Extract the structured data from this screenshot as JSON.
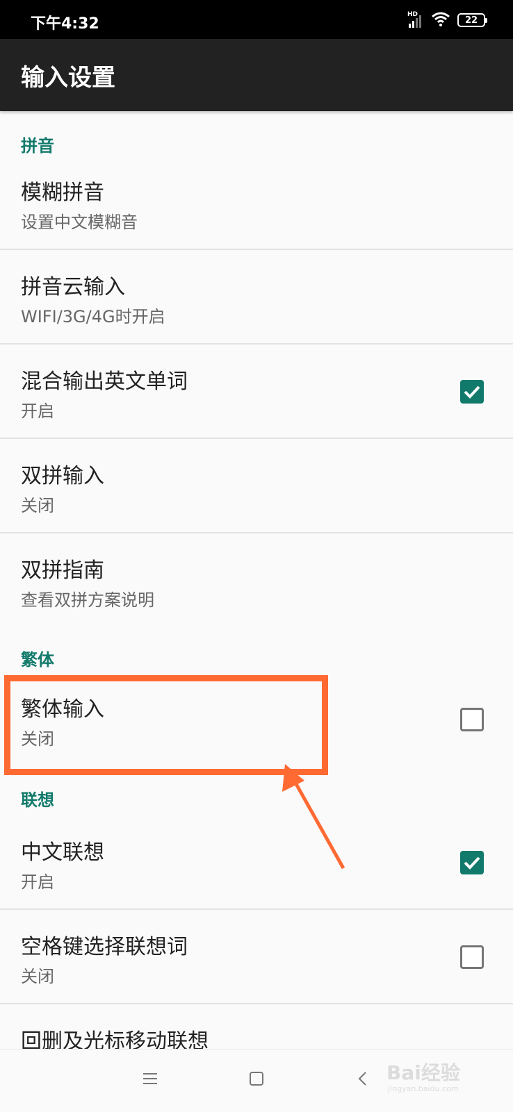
{
  "status": {
    "time": "下午4:32",
    "network": "HD",
    "battery": "22"
  },
  "appbar": {
    "title": "输入设置"
  },
  "sections": {
    "pinyin": "拼音",
    "traditional": "繁体",
    "association": "联想"
  },
  "rows": [
    {
      "title": "模糊拼音",
      "subtitle": "设置中文模糊音",
      "checkbox": null
    },
    {
      "title": "拼音云输入",
      "subtitle": "WIFI/3G/4G时开启",
      "checkbox": null
    },
    {
      "title": "混合输出英文单词",
      "subtitle": "开启",
      "checkbox": true
    },
    {
      "title": "双拼输入",
      "subtitle": "关闭",
      "checkbox": null
    },
    {
      "title": "双拼指南",
      "subtitle": "查看双拼方案说明",
      "checkbox": null
    },
    {
      "title": "繁体输入",
      "subtitle": "关闭",
      "checkbox": false
    },
    {
      "title": "中文联想",
      "subtitle": "开启",
      "checkbox": true
    },
    {
      "title": "空格键选择联想词",
      "subtitle": "关闭",
      "checkbox": false
    },
    {
      "title": "回删及光标移动联想",
      "subtitle": "",
      "checkbox": null
    }
  ],
  "colors": {
    "accent": "#127a6b",
    "highlight": "#ff6a33"
  },
  "watermark": {
    "text": "Bai经验",
    "sub": "jingyan.baidu.com"
  }
}
